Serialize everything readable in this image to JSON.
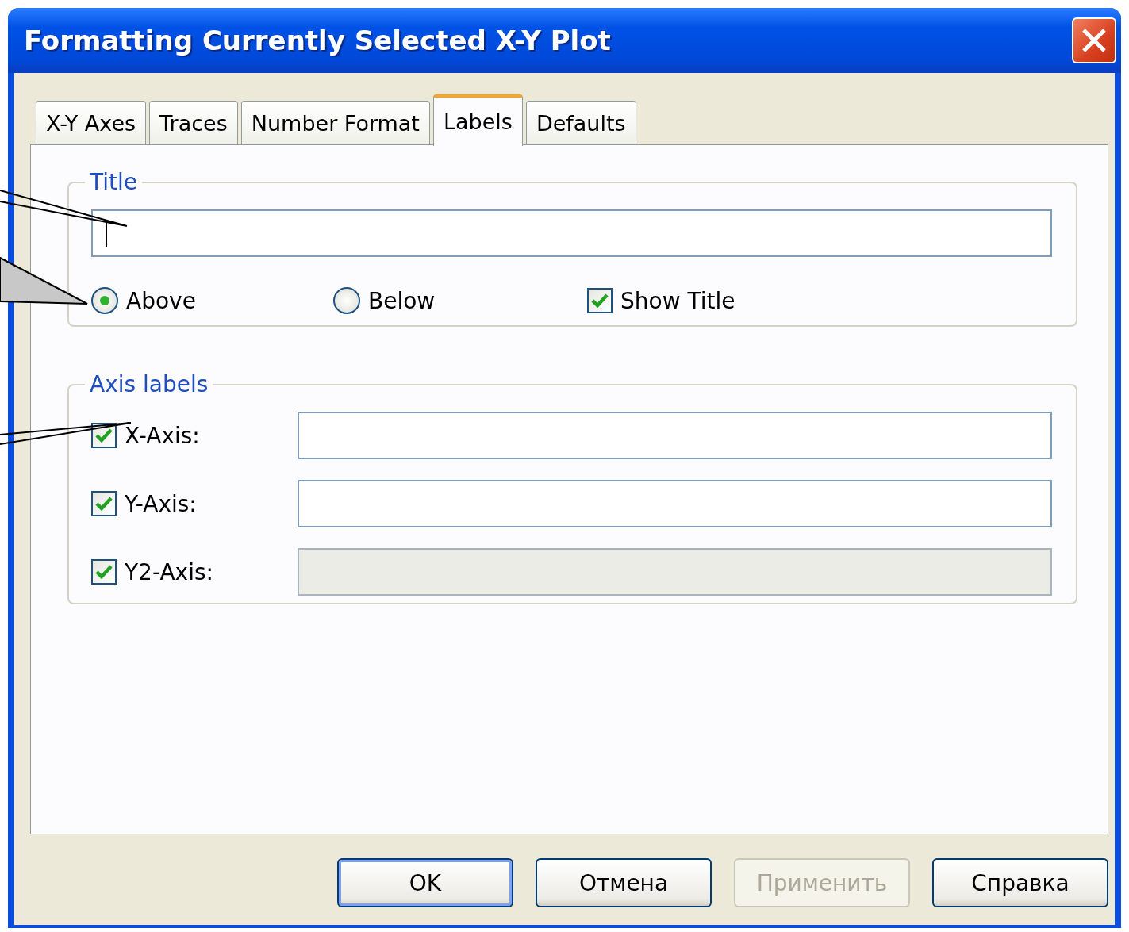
{
  "window": {
    "title": "Formatting Currently Selected X-Y Plot"
  },
  "tabs": [
    {
      "label": "X-Y Axes",
      "selected": false
    },
    {
      "label": "Traces",
      "selected": false
    },
    {
      "label": "Number Format",
      "selected": false
    },
    {
      "label": "Labels",
      "selected": true
    },
    {
      "label": "Defaults",
      "selected": false
    }
  ],
  "title_group": {
    "legend": "Title",
    "field": {
      "focused": true
    },
    "position_options": [
      {
        "label": "Above",
        "selected": true
      },
      {
        "label": "Below",
        "selected": false
      }
    ],
    "show_title": {
      "label": "Show Title",
      "checked": true
    }
  },
  "axis_labels": {
    "legend": "Axis labels",
    "rows": [
      {
        "label": "X-Axis:",
        "checked": true,
        "disabled": false
      },
      {
        "label": "Y-Axis:",
        "checked": true,
        "disabled": false
      },
      {
        "label": "Y2-Axis:",
        "checked": true,
        "disabled": true
      }
    ]
  },
  "buttons": [
    {
      "label": "OK",
      "default": true,
      "disabled": false
    },
    {
      "label": "Отмена",
      "default": false,
      "disabled": false
    },
    {
      "label": "Применить",
      "default": false,
      "disabled": true
    },
    {
      "label": "Справка",
      "default": false,
      "disabled": false
    }
  ]
}
